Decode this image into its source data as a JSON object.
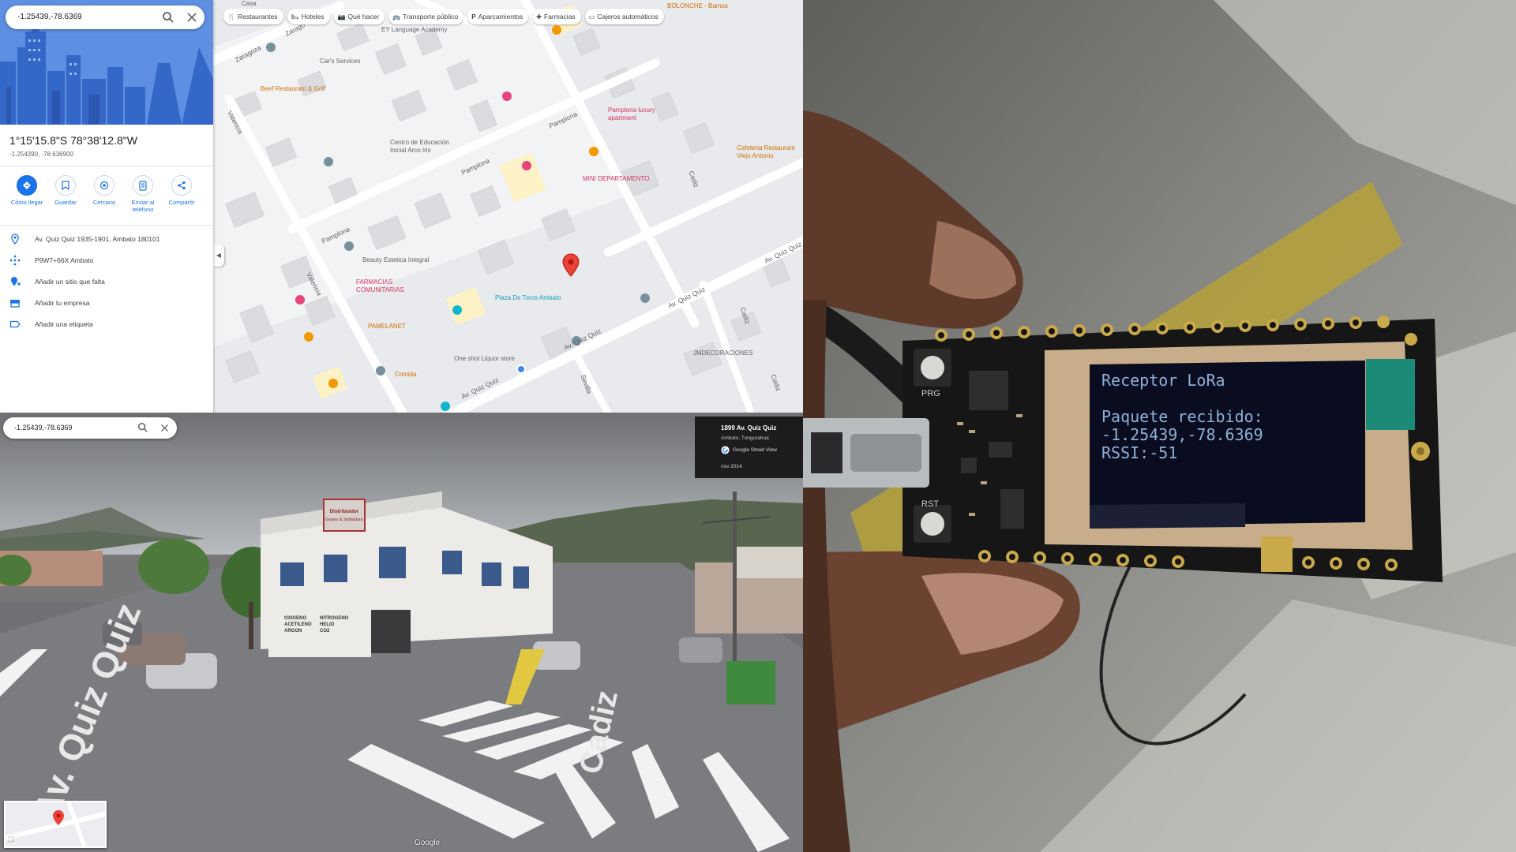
{
  "maps": {
    "search": {
      "query": "-1.25439,-78.6369"
    },
    "place": {
      "dms": "1°15'15.8\"S 78°38'12.8\"W",
      "decimal": "-1.254390, -78.636900"
    },
    "actions": [
      {
        "label": "Cómo llegar",
        "icon": "directions-icon"
      },
      {
        "label": "Guardar",
        "icon": "bookmark-icon"
      },
      {
        "label": "Cercano",
        "icon": "nearby-icon"
      },
      {
        "label": "Enviar al teléfono",
        "icon": "send-to-phone-icon"
      },
      {
        "label": "Compartir",
        "icon": "share-icon"
      }
    ],
    "info_rows": [
      {
        "text": "Av. Quiz Quiz 1935-1901, Ambato 180101",
        "icon": "location-pin-icon"
      },
      {
        "text": "P9W7+66X Ambato",
        "icon": "plus-code-icon"
      },
      {
        "text": "Añadir un sitio que falta",
        "icon": "add-place-icon"
      },
      {
        "text": "Añadir tu empresa",
        "icon": "business-icon"
      },
      {
        "text": "Añadir una etiqueta",
        "icon": "label-icon"
      }
    ],
    "chips": [
      {
        "label": "Restaurantes",
        "glyph": "🍴"
      },
      {
        "label": "Hoteles",
        "glyph": "🛏"
      },
      {
        "label": "Qué hacer",
        "glyph": "📷"
      },
      {
        "label": "Transporte público",
        "glyph": "🚌"
      },
      {
        "label": "Aparcamientos",
        "glyph": "P"
      },
      {
        "label": "Farmacias",
        "glyph": "✚"
      },
      {
        "label": "Cajeros automáticos",
        "glyph": "▭"
      }
    ],
    "labels": {
      "bolonche": "BOLONCHE - Bamos",
      "ey": "EY Language Academy",
      "cars": "Car's Services",
      "beef": "Beef Restaurant & Grill",
      "pamplona_apt_1": "Pamplona luxury",
      "pamplona_apt_2": "apartment",
      "centro_1": "Centro de Educación",
      "centro_2": "Inicial Arco Iris",
      "cafeteria_1": "Cafeteria Restaurant",
      "cafeteria_2": "Viejo Antonio",
      "mini": "MINI DEPARTAMENTO",
      "beauty": "Beauty Estetica Integral",
      "farmacias_1": "FARMACIAS",
      "farmacias_2": "COMUNITARIAS",
      "plaza": "Plaza De Toros Ambato",
      "pamelanet": "PAMELANET",
      "oneshot": "One shot Liquor store",
      "comida": "Comida",
      "jmdeco": "JMDECORACIONES",
      "street_zaragoza": "Zaragoza",
      "street_zarago": "Zarago",
      "street_valencia": "Valencia",
      "street_pamplona": "Pamplona",
      "street_cadiz": "Cadiz",
      "street_quiz": "Av. Quiz Quiz",
      "street_sevilla": "Sevilla",
      "casa": "Casa"
    },
    "colors": {
      "accent": "#1a73e8",
      "pin": "#ea4335"
    }
  },
  "streetview": {
    "search": {
      "query": "-1.25439,-78.6369"
    },
    "info": {
      "address": "1899 Av. Quiz Quiz",
      "locality": "Ambato, Tungurahua",
      "source": "Google Street View",
      "date": "nov 2014"
    },
    "road_labels": {
      "quiz": "Av. Quiz Quiz",
      "cadiz": "Cadiz"
    },
    "sign": {
      "line1": "Distribuidor",
      "line2": "Gases & Soldadura"
    },
    "wall": {
      "line1": "OXIGENO",
      "line2": "ACETILENO",
      "line3": "ARGON",
      "line4": "NITROGENO",
      "line5": "HELIO",
      "line6": "CO2"
    },
    "watermark": "Google"
  },
  "device": {
    "oled": {
      "title": "Receptor LoRa",
      "line1": "Paquete recibido:",
      "line2": "-1.25439,-78.6369",
      "line3": "RSSI:-51"
    },
    "silkscreen": {
      "prg": "PRG",
      "rst": "RST"
    }
  }
}
